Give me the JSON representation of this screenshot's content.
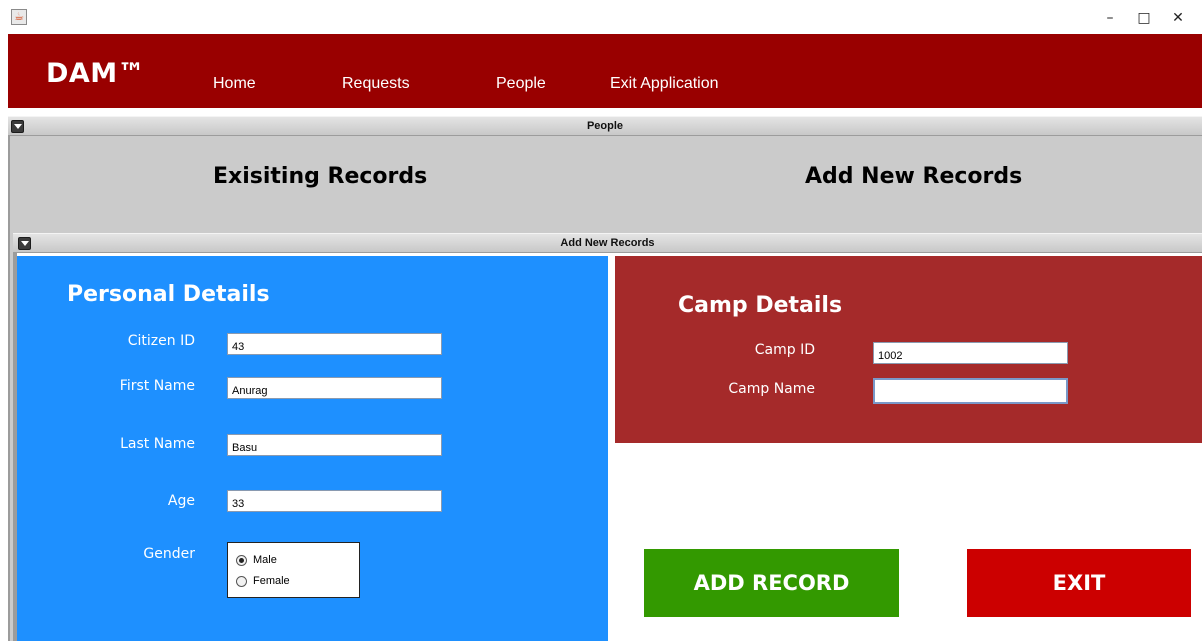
{
  "window": {
    "app_icon": "java-cup-icon",
    "minimize": "–",
    "maximize": "□",
    "close": "✕"
  },
  "navbar": {
    "brand": "DAM™",
    "items": [
      "Home",
      "Requests",
      "People",
      "Exit Application"
    ],
    "color": "#990000"
  },
  "people_frame": {
    "title": "People",
    "tabs": [
      "Exisiting Records",
      "Add New Records"
    ]
  },
  "add_frame": {
    "title": "Add New Records"
  },
  "personal": {
    "title": "Personal Details",
    "color": "#1e90ff",
    "fields": {
      "citizen_id": {
        "label": "Citizen ID",
        "value": "43"
      },
      "first_name": {
        "label": "First Name",
        "value": "Anurag"
      },
      "last_name": {
        "label": "Last Name",
        "value": "Basu"
      },
      "age": {
        "label": "Age",
        "value": "33"
      }
    },
    "gender": {
      "label": "Gender",
      "options": [
        "Male",
        "Female"
      ],
      "selected": "Male"
    }
  },
  "camp": {
    "title": "Camp Details",
    "color": "#a52a2a",
    "fields": {
      "camp_id": {
        "label": "Camp ID",
        "value": "1002"
      },
      "camp_name": {
        "label": "Camp Name",
        "value": ""
      }
    }
  },
  "actions": {
    "add_label": "ADD RECORD",
    "exit_label": "EXIT",
    "add_color": "#339900",
    "exit_color": "#cc0000"
  }
}
